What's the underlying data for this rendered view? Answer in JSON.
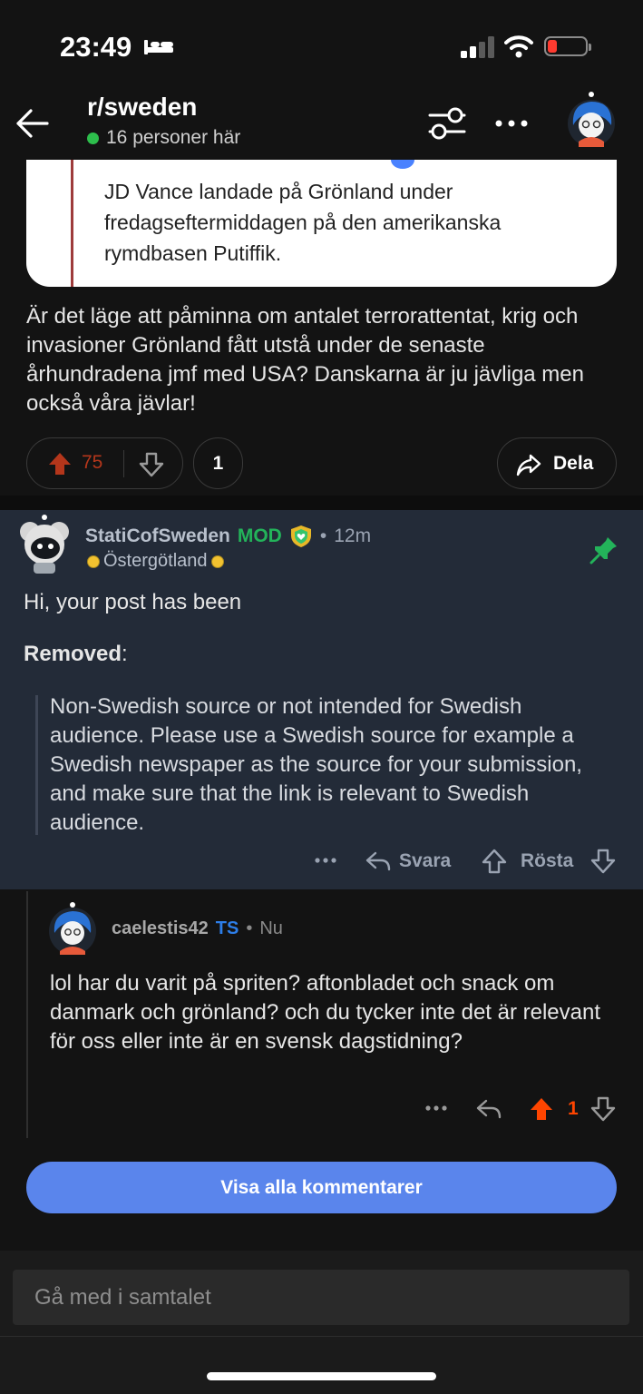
{
  "status_bar": {
    "time": "23:49",
    "icons": [
      "bed-icon",
      "signal-icon",
      "wifi-icon",
      "battery-low-icon"
    ],
    "battery_color": "#ff3b30"
  },
  "header": {
    "subreddit": "r/sweden",
    "online_text": "16 personer här",
    "online_color": "#2dbe4c",
    "icons": [
      "back-arrow-icon",
      "filter-icon",
      "more-icon",
      "user-avatar"
    ]
  },
  "post": {
    "embedded_quote": "JD Vance landade på Grönland under fredagseftermiddagen på den amerikanska rymdbasen Putiffik.",
    "body": "Är det läge att påminna om antalet terrorattentat, krig och invasioner Grönland fått utstå under de senaste århundradena jmf med USA? Danskarna är ju jävliga men också våra jävlar!",
    "score": "75",
    "comment_count": "1",
    "share_label": "Dela",
    "upvote_color": "#b4361b"
  },
  "mod_comment": {
    "username": "StatiCofSweden",
    "badge": "MOD",
    "time": "12m",
    "flair": "Östergötland",
    "line1": "Hi, your post has been",
    "removed_label": "Removed",
    "removed_suffix": ":",
    "quote": "Non-Swedish source or not intended for Swedish audience. Please use a Swedish source for example a Swedish newspaper as the source for your submission, and make sure that the link is relevant to Swedish audience.",
    "reply_label": "Svara",
    "vote_label": "Rösta",
    "mod_color": "#23b35a",
    "pin_color": "#23b35a"
  },
  "reply": {
    "username": "caelestis42",
    "badge": "TS",
    "time": "Nu",
    "text": "lol har du varit på spriten? aftonbladet och snack om danmark och grönland? och du tycker inte det är relevant för oss eller inte är en svensk dagstidning?",
    "score": "1",
    "badge_color": "#2d7ee8"
  },
  "show_all_label": "Visa alla kommentarer",
  "composer_placeholder": "Gå med i samtalet"
}
